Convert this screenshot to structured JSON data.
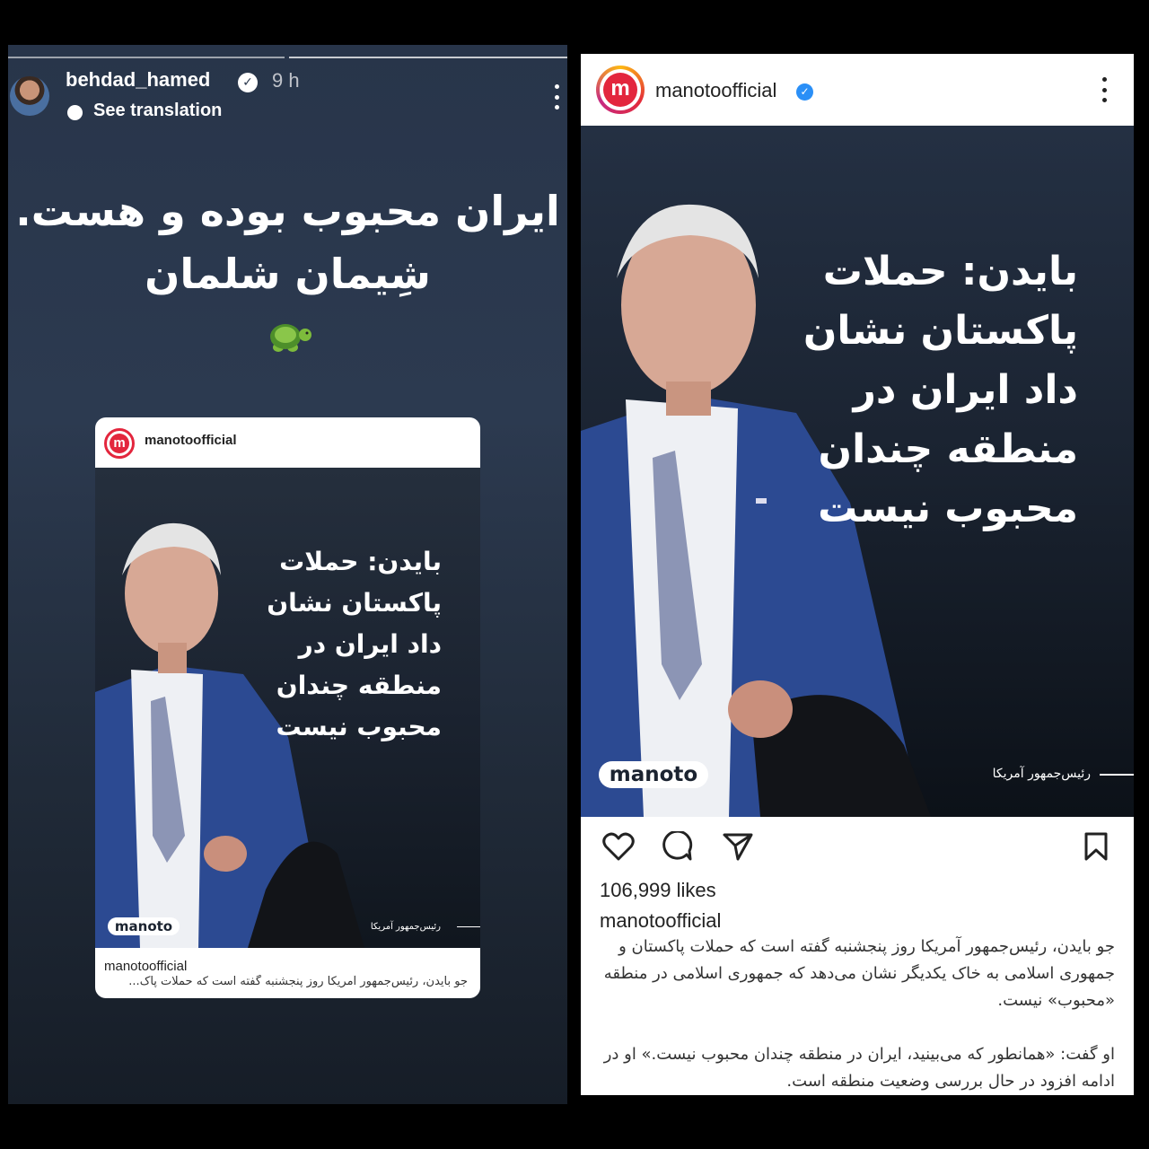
{
  "story": {
    "username": "behdad_hamed",
    "time": "9 h",
    "see_translation": "See translation",
    "text_line1": "ایران محبوب بوده و هست.",
    "text_line2": "شِیمان شلمان",
    "emoji": "turtle",
    "card": {
      "username": "manotoofficial",
      "headline": [
        "بایدن: حملات",
        "پاکستان نشان",
        "داد ایران در",
        "منطقه چندان",
        "محبوب نیست"
      ],
      "logo": "manoto",
      "credit": "رئیس‌جمهور آمریکا",
      "caption_user": "manotoofficial",
      "caption_text": "جو بایدن، رئیس‌جمهور آمریکا روز پنجشنبه گفته است که حملات پاک..."
    }
  },
  "post": {
    "username": "manotoofficial",
    "avatar_letter": "m",
    "headline": [
      "بایدن: حملات",
      "پاکستان نشان",
      "داد ایران در",
      "منطقه چندان",
      "محبوب نیست"
    ],
    "logo": "manoto",
    "credit": "رئیس‌جمهور آمریکا",
    "likes": "106,999 likes",
    "caption_user": "manotoofficial",
    "caption_p1": "جو بایدن، رئیس‌جمهور آمریکا روز پنجشنبه گفته است که حملات پاکستان و جمهوری اسلامی به خاک یکدیگر نشان می‌دهد که جمهوری اسلامی در منطقه «محبوب» نیست.",
    "caption_p2": "او گفت: «همانطور که می‌بینید، ایران در منطقه چندان محبوب نیست.» او در ادامه افزود در حال بررسی وضعیت منطقه است."
  },
  "colors": {
    "brand_red": "#e3263d",
    "verified_blue": "#2a8ff7",
    "story_bg": "#2c3a50"
  }
}
